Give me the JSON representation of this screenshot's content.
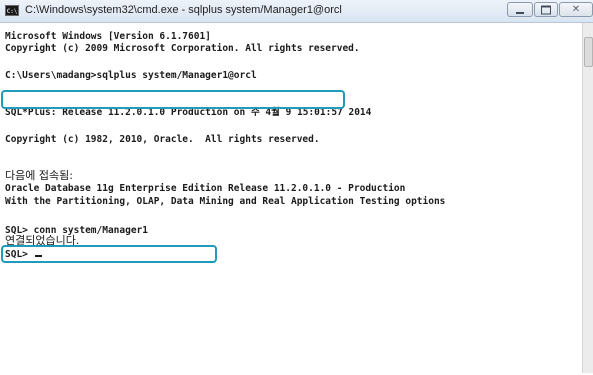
{
  "window": {
    "title": "C:\\Windows\\system32\\cmd.exe - sqlplus  system/Manager1@orcl",
    "icon": "console-app-icon",
    "controls": [
      "minimize",
      "maximize",
      "close"
    ]
  },
  "console": {
    "lines": [
      "Microsoft Windows [Version 6.1.7601]",
      "Copyright (c) 2009 Microsoft Corporation. All rights reserved.",
      "C:\\Users\\madang>sqlplus system/Manager1@orcl",
      "SQL*Plus: Release 11.2.0.1.0 Production on 수 4월 9 15:01:57 2014",
      "Copyright (c) 1982, 2010, Oracle.  All rights reserved.",
      "다음에 접속됨:",
      "Oracle Database 11g Enterprise Edition Release 11.2.0.1.0 - Production",
      "With the Partitioning, OLAP, Data Mining and Real Application Testing options",
      "SQL> conn system/Manager1",
      "연결되었습니다.",
      "SQL> "
    ]
  },
  "colors": {
    "highlight": "#1f9cbb",
    "console_background": "#ffffff",
    "console_text": "#1b1b1b"
  }
}
